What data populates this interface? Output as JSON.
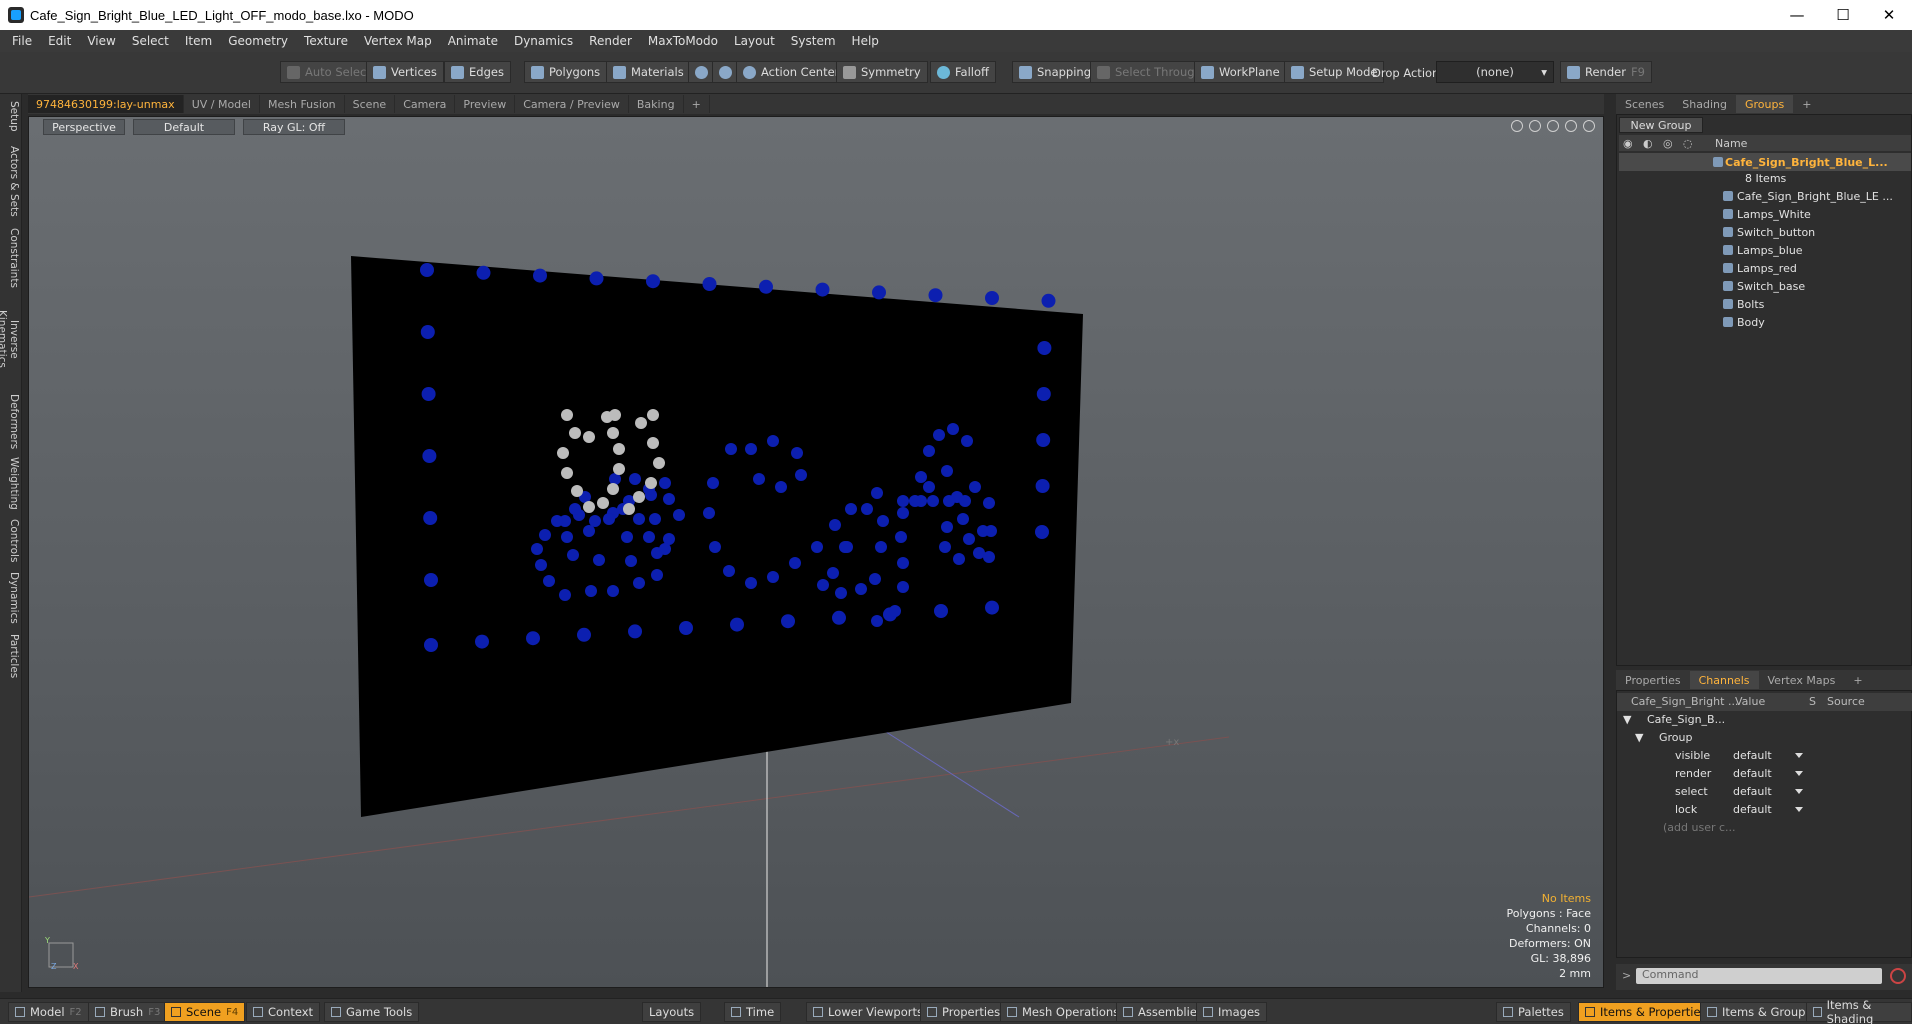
{
  "window": {
    "title": "Cafe_Sign_Bright_Blue_LED_Light_OFF_modo_base.lxo - MODO",
    "minimize": "—",
    "maximize": "☐",
    "close": "✕"
  },
  "menu": [
    "File",
    "Edit",
    "View",
    "Select",
    "Item",
    "Geometry",
    "Texture",
    "Vertex Map",
    "Animate",
    "Dynamics",
    "Render",
    "MaxToModo",
    "Layout",
    "System",
    "Help"
  ],
  "toolbar": {
    "auto_select": "Auto Select",
    "vertices": "Vertices",
    "edges": "Edges",
    "polygons": "Polygons",
    "materials": "Materials",
    "action_center": "Action Center",
    "symmetry": "Symmetry",
    "falloff": "Falloff",
    "snapping": "Snapping",
    "select_through": "Select Through",
    "workplane": "WorkPlane",
    "setup_mode": "Setup Mode",
    "drop_action_label": "Drop Action",
    "drop_action_value": "(none)",
    "render": "Render",
    "render_key": "F9"
  },
  "left_tabs": [
    "Setup",
    "Actors & Sets",
    "Constraints",
    "Inverse Kinematics",
    "Deformers",
    "Weighting",
    "Controls",
    "Dynamics",
    "Particles"
  ],
  "viewport_tabs": [
    "97484630199:lay-unmax",
    "UV / Model",
    "Mesh Fusion",
    "Scene",
    "Camera",
    "Preview",
    "Camera / Preview",
    "Baking",
    "+"
  ],
  "viewport": {
    "view": "Perspective",
    "shading": "Default",
    "raygl": "Ray GL: Off",
    "hud": {
      "status": "No Items",
      "polygons": "Polygons : Face",
      "channels": "Channels: 0",
      "deformers": "Deformers: ON",
      "gl": "GL: 38,896",
      "unit": "2 mm"
    },
    "axis_y": "Y",
    "axis_x": "X",
    "axis_z": "Z"
  },
  "right_tabs": [
    "Scenes",
    "Shading",
    "Groups",
    "+"
  ],
  "groups": {
    "new_group": "New Group",
    "name_header": "Name",
    "root": "Cafe_Sign_Bright_Blue_L...",
    "root_count": "8 Items",
    "items": [
      "Cafe_Sign_Bright_Blue_LE ...",
      "Lamps_White",
      "Switch_button",
      "Lamps_blue",
      "Lamps_red",
      "Switch_base",
      "Bolts",
      "Body"
    ]
  },
  "channel_tabs": [
    "Properties",
    "Channels",
    "Vertex Maps",
    "+"
  ],
  "channels": {
    "headers": [
      "Cafe_Sign_Bright ...",
      "Value",
      "S",
      "Source"
    ],
    "item": "Cafe_Sign_B...",
    "group": "Group",
    "rows": [
      {
        "name": "visible",
        "value": "default"
      },
      {
        "name": "render",
        "value": "default"
      },
      {
        "name": "select",
        "value": "default"
      },
      {
        "name": "lock",
        "value": "default"
      }
    ],
    "add_user": "(add user c..."
  },
  "command": {
    "placeholder": "Command"
  },
  "bottombar": {
    "model": "Model",
    "model_key": "F2",
    "brush": "Brush",
    "brush_key": "F3",
    "scene": "Scene",
    "scene_key": "F4",
    "context": "Context",
    "game_tools": "Game Tools",
    "layouts": "Layouts",
    "time": "Time",
    "lower_viewports": "Lower Viewports",
    "properties": "Properties",
    "mesh_operations": "Mesh Operations",
    "assemblies": "Assemblies",
    "images": "Images",
    "palettes": "Palettes",
    "items_properties": "Items & Properties",
    "items_groups": "Items & Groups",
    "items_shading": "Items & Shading"
  },
  "colors": {
    "accent": "#ffb43c",
    "led_blue": "#0c1fb0",
    "led_white": "#bcbcbc",
    "sign": "#000000"
  }
}
